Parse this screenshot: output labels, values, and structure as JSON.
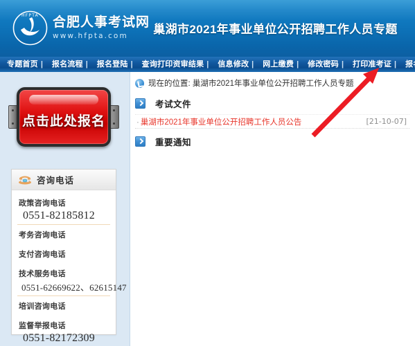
{
  "header": {
    "logo_title": "合肥人事考试网",
    "logo_url": "www.hfpta.com",
    "logo_mark_text": "HFPTA",
    "banner_title": "巢湖市2021年事业单位公开招聘工作人员专题"
  },
  "nav": {
    "separator": "|",
    "items": [
      {
        "label": "专题首页"
      },
      {
        "label": "报名流程"
      },
      {
        "label": "报名登陆"
      },
      {
        "label": "查询打印资审结果"
      },
      {
        "label": "信息修改"
      },
      {
        "label": "网上缴费"
      },
      {
        "label": "修改密码"
      },
      {
        "label": "打印准考证"
      },
      {
        "label": "报名情况浏览"
      }
    ]
  },
  "sidebar": {
    "signup_button_label": "点击此处报名",
    "contact": {
      "title": "咨询电话",
      "rows": [
        {
          "label": "政策咨询电话",
          "number": "0551-82185812"
        },
        {
          "label": "考务咨询电话",
          "number": ""
        },
        {
          "label": "支付咨询电话",
          "number": ""
        },
        {
          "label": "技术服务电话",
          "number": "0551-62669622、62615147"
        },
        {
          "label": "培训咨询电话",
          "number": ""
        },
        {
          "label": "监督举报电话",
          "number": "0551-82172309"
        }
      ]
    }
  },
  "main": {
    "breadcrumb_prefix": "现在的位置:",
    "breadcrumb_current": "巢湖市2021年事业单位公开招聘工作人员专题",
    "breadcrumb_full": "现在的位置: 巢湖市2021年事业单位公开招聘工作人员专题",
    "sections": [
      {
        "title": "考试文件",
        "items": [
          {
            "title": "巢湖市2021年事业单位公开招聘工作人员公告",
            "date": "[21-10-07]"
          }
        ]
      },
      {
        "title": "重要通知",
        "items": []
      }
    ]
  },
  "annotation": {
    "arrow_color": "#ec1c24",
    "arrow_target": "报名情况浏览"
  },
  "colors": {
    "header_blue": "#0d72b8",
    "nav_blue": "#12589f",
    "sidebar_bg": "#dbe8f4",
    "link_red": "#e8352a",
    "button_red": "#e01414",
    "date_gray": "#8e8e8e"
  }
}
